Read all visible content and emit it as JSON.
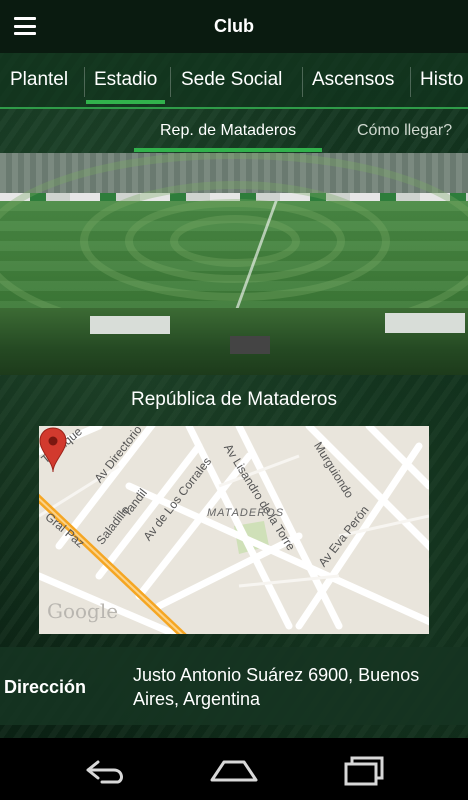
{
  "appbar": {
    "title": "Club",
    "menu_icon": "hamburger-menu-icon"
  },
  "tabs": [
    {
      "label": "Plantel",
      "active": false
    },
    {
      "label": "Estadio",
      "active": true
    },
    {
      "label": "Sede Social",
      "active": false
    },
    {
      "label": "Ascensos",
      "active": false
    },
    {
      "label": "Histo",
      "active": false
    }
  ],
  "subtabs": [
    {
      "label": "Rep. de Mataderos",
      "active": true
    },
    {
      "label": "Cómo llegar?",
      "active": false
    }
  ],
  "stadium": {
    "caption": "República de Mataderos"
  },
  "map": {
    "streets": [
      "Tapalque",
      "Av Directorio",
      "Tandil",
      "Saladillo",
      "Gral Paz",
      "Av de Los Corrales",
      "Av Lisandro de la Torre",
      "Murguiondo",
      "Av Eva Perón"
    ],
    "neighborhood": "MATADEROS",
    "logo": "Google"
  },
  "address": {
    "label": "Dirección",
    "value": "Justo Antonio Suárez 6900, Buenos Aires, Argentina"
  },
  "colors": {
    "accent": "#31b24c",
    "appbar": "#0a1b10",
    "pin": "#d23a2e",
    "highway": "#f5a623"
  },
  "navbar": {
    "icons": [
      "back-icon",
      "home-icon",
      "recent-apps-icon"
    ]
  }
}
